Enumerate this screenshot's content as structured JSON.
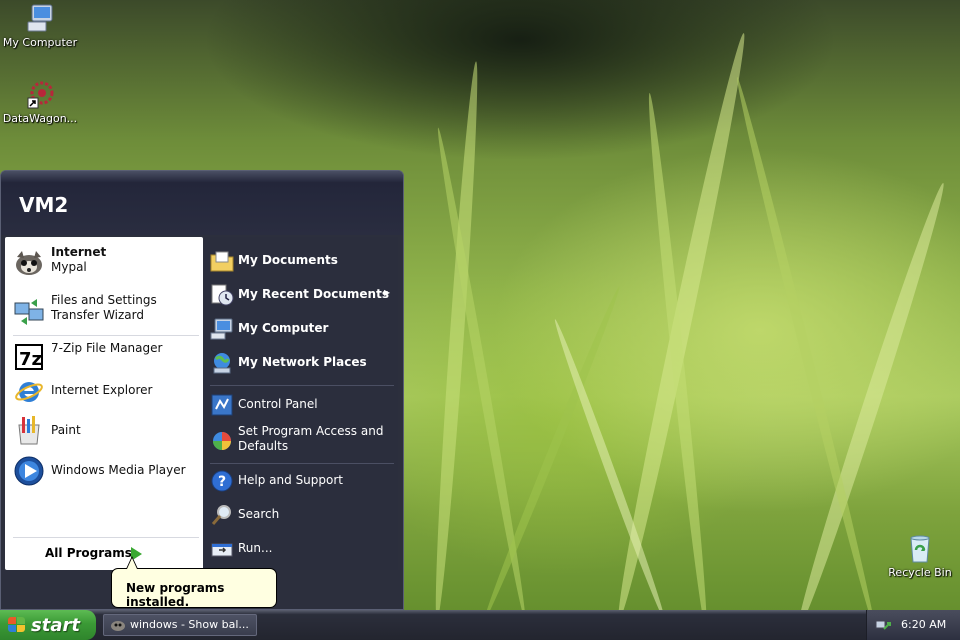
{
  "desktop": {
    "icons": [
      {
        "label": "My Computer",
        "icon": "my-computer-icon"
      },
      {
        "label": "DataWagon...",
        "icon": "datawagon-shortcut-icon"
      },
      {
        "label": "Recycle Bin",
        "icon": "recycle-bin-icon"
      }
    ]
  },
  "start_menu": {
    "user_name": "VM2",
    "pinned": [
      {
        "title": "Internet",
        "subtitle": "Mypal",
        "icon": "mypal-browser-icon"
      },
      {
        "title": "Files and Settings Transfer Wizard",
        "icon": "transfer-wizard-icon"
      }
    ],
    "recent": [
      {
        "title": "7-Zip File Manager",
        "icon": "7zip-icon"
      },
      {
        "title": "Internet Explorer",
        "icon": "internet-explorer-icon"
      },
      {
        "title": "Paint",
        "icon": "paint-icon"
      },
      {
        "title": "Windows Media Player",
        "icon": "media-player-icon"
      }
    ],
    "all_programs": "All Programs",
    "places": [
      {
        "label": "My Documents",
        "icon": "my-documents-icon"
      },
      {
        "label": "My Recent Documents",
        "icon": "recent-documents-icon",
        "has_submenu": true
      },
      {
        "label": "My Computer",
        "icon": "my-computer-icon"
      },
      {
        "label": "My Network Places",
        "icon": "network-places-icon"
      }
    ],
    "settings": [
      {
        "label": "Control Panel",
        "icon": "control-panel-icon"
      },
      {
        "label": "Set Program Access and Defaults",
        "icon": "program-access-icon"
      }
    ],
    "tools": [
      {
        "label": "Help and Support",
        "icon": "help-icon"
      },
      {
        "label": "Search",
        "icon": "search-icon"
      },
      {
        "label": "Run...",
        "icon": "run-icon"
      }
    ],
    "submenu_arrow": "▸"
  },
  "balloon": {
    "text": "New programs installed."
  },
  "taskbar": {
    "start_label": "start",
    "task_button": "windows - Show bal...",
    "clock": "6:20 AM"
  },
  "colors": {
    "menu_dark": "#2c2f3d",
    "start_green": "#3b9a36",
    "balloon_bg": "#ffffe1"
  }
}
